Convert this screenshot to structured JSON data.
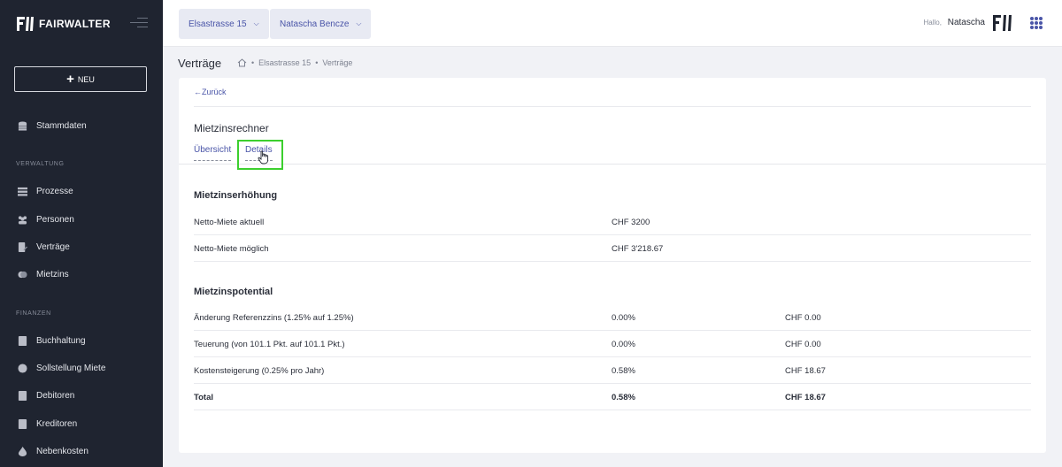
{
  "brand": {
    "name": "FAIRWALTER"
  },
  "sidebar": {
    "new_label": "NEU",
    "stammdaten": "Stammdaten",
    "section_verwaltung": "VERWALTUNG",
    "verwaltung": [
      "Prozesse",
      "Personen",
      "Verträge",
      "Mietzins"
    ],
    "section_finanzen": "FINANZEN",
    "finanzen": [
      "Buchhaltung",
      "Sollstellung Miete",
      "Debitoren",
      "Kreditoren",
      "Nebenkosten"
    ]
  },
  "topbar": {
    "property_select": "Elsastrasse 15",
    "person_select": "Natascha Bencze",
    "hallo": "Hallo,",
    "user": "Natascha"
  },
  "breadcrumb": {
    "title": "Verträge",
    "items": [
      "Elsastrasse 15",
      "Verträge"
    ],
    "separator": "•"
  },
  "card": {
    "back": "←Zurück",
    "title": "Mietzinsrechner",
    "tabs": [
      "Übersicht",
      "Details"
    ],
    "increase": {
      "heading": "Mietzinserhöhung",
      "rows": [
        {
          "label": "Netto-Miete aktuell",
          "value": "CHF 3200"
        },
        {
          "label": "Netto-Miete möglich",
          "value": "CHF 3'218.67"
        }
      ]
    },
    "potential": {
      "heading": "Mietzinspotential",
      "rows": [
        {
          "label": "Änderung Referenzzins (1.25% auf 1.25%)",
          "percent": "0.00%",
          "amount": "CHF 0.00"
        },
        {
          "label": "Teuerung (von 101.1 Pkt. auf 101.1 Pkt.)",
          "percent": "0.00%",
          "amount": "CHF 0.00"
        },
        {
          "label": "Kostensteigerung (0.25% pro Jahr)",
          "percent": "0.58%",
          "amount": "CHF 18.67"
        },
        {
          "label": "Total",
          "percent": "0.58%",
          "amount": "CHF 18.67"
        }
      ]
    }
  },
  "colors": {
    "sidebar_bg": "#1f2430",
    "accent": "#4a55a8",
    "focus": "#3ccf2e"
  }
}
